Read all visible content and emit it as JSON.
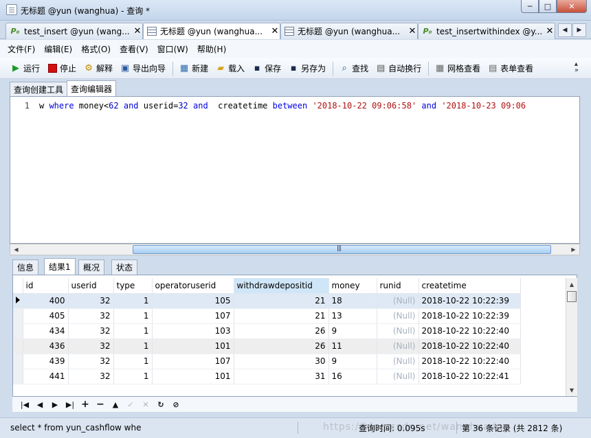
{
  "window": {
    "title": "无标题 @yun (wanghua) - 查询 *",
    "buttons": {
      "minimize": "─",
      "maximize": "□",
      "close": "✕"
    }
  },
  "doc_tabs": [
    {
      "icon": "P₀",
      "label": "test_insert @yun (wang..."
    },
    {
      "icon": "grid",
      "label": "无标题 @yun (wanghua..."
    },
    {
      "icon": "grid",
      "label": "无标题 @yun (wanghua..."
    },
    {
      "icon": "P₀",
      "label": "test_insertwithindex @y..."
    }
  ],
  "tab_nav": {
    "prev": "◀",
    "next": "▶"
  },
  "menu": [
    "文件(F)",
    "编辑(E)",
    "格式(O)",
    "查看(V)",
    "窗口(W)",
    "帮助(H)"
  ],
  "toolbar": {
    "run": "运行",
    "stop": "停止",
    "explain": "解释",
    "export": "导出向导",
    "new": "新建",
    "load": "载入",
    "save": "保存",
    "save_as": "另存为",
    "find": "查找",
    "wrap": "自动换行",
    "grid_view": "网格查看",
    "form_view": "表单查看",
    "more": "»"
  },
  "editor_tabs": {
    "builder": "查询创建工具",
    "editor": "查询编辑器"
  },
  "editor": {
    "line_number": "1",
    "code": [
      {
        "t": "w ",
        "c": "txt"
      },
      {
        "t": "where",
        "c": "kw"
      },
      {
        "t": " money<",
        "c": "txt"
      },
      {
        "t": "62",
        "c": "num"
      },
      {
        "t": " ",
        "c": "txt"
      },
      {
        "t": "and",
        "c": "kw"
      },
      {
        "t": " userid=",
        "c": "txt"
      },
      {
        "t": "32",
        "c": "num"
      },
      {
        "t": " ",
        "c": "txt"
      },
      {
        "t": "and",
        "c": "kw"
      },
      {
        "t": "  createtime ",
        "c": "txt"
      },
      {
        "t": "between",
        "c": "kw"
      },
      {
        "t": " ",
        "c": "txt"
      },
      {
        "t": "'2018-10-22 09:06:58'",
        "c": "str"
      },
      {
        "t": " ",
        "c": "txt"
      },
      {
        "t": "and",
        "c": "kw"
      },
      {
        "t": " ",
        "c": "txt"
      },
      {
        "t": "'2018-10-23 09:06",
        "c": "str"
      }
    ]
  },
  "result_tabs": [
    "信息",
    "结果1",
    "概况",
    "状态"
  ],
  "grid": {
    "columns": [
      "id",
      "userid",
      "type",
      "operatoruserid",
      "withdrawdepositid",
      "money",
      "runid",
      "createtime"
    ],
    "selected_column": "withdrawdepositid",
    "rows": [
      [
        "400",
        "32",
        "1",
        "105",
        "21",
        "18",
        "(Null)",
        "2018-10-22 10:22:39"
      ],
      [
        "405",
        "32",
        "1",
        "107",
        "21",
        "13",
        "(Null)",
        "2018-10-22 10:22:39"
      ],
      [
        "434",
        "32",
        "1",
        "103",
        "26",
        "9",
        "(Null)",
        "2018-10-22 10:22:40"
      ],
      [
        "436",
        "32",
        "1",
        "101",
        "26",
        "11",
        "(Null)",
        "2018-10-22 10:22:40"
      ],
      [
        "439",
        "32",
        "1",
        "107",
        "30",
        "9",
        "(Null)",
        "2018-10-22 10:22:40"
      ],
      [
        "441",
        "32",
        "1",
        "101",
        "31",
        "16",
        "(Null)",
        "2018-10-22 10:22:41"
      ]
    ]
  },
  "navbar": {
    "first": "|◀",
    "prev": "◀",
    "next": "▶",
    "last": "▶|",
    "add": "+",
    "delete": "−",
    "up": "▲",
    "apply": "✓",
    "discard": "✕",
    "refresh": "↻",
    "stop": "⊘"
  },
  "status": {
    "sql": "select * from yun_cashflow whe",
    "time": "查询时间: 0.095s",
    "record": "第 36 条记录 (共 2812 条)",
    "watermark": "https://blog.csdn.net/wanghuadoc"
  },
  "colors": {
    "accent": "#cfe6f8",
    "keyword": "#0000e0",
    "string": "#b01010",
    "null": "#a7b1bf"
  }
}
